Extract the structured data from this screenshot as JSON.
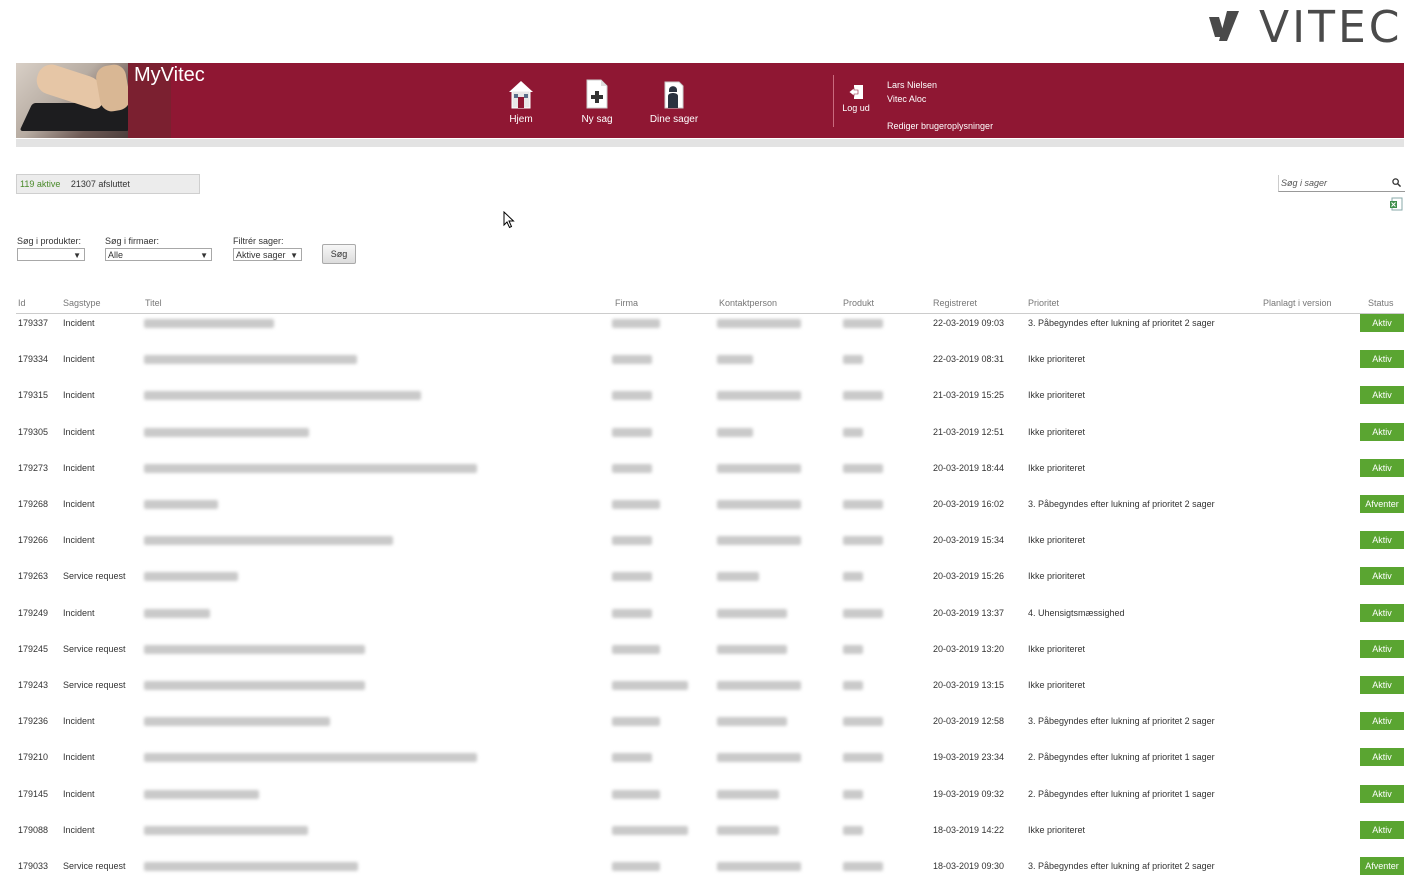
{
  "brand": {
    "logo_text": "VITEC",
    "logo_color": "#4a4a4a",
    "icon": "vitec-logo-icon"
  },
  "header": {
    "app_title": "MyVitec",
    "bg_color": "#8f1733",
    "nav": [
      {
        "label": "Hjem",
        "icon": "home-icon"
      },
      {
        "label": "Ny sag",
        "icon": "new-case-icon"
      },
      {
        "label": "Dine sager",
        "icon": "my-cases-icon"
      }
    ],
    "logout_label": "Log ud",
    "user_name": "Lars Nielsen",
    "company": "Vitec Aloc",
    "edit_user_label": "Rediger brugeroplysninger"
  },
  "counts": {
    "active": "119 aktive",
    "closed": "21307 afsluttet"
  },
  "search": {
    "placeholder": "Søg i sager"
  },
  "filters": {
    "products_label": "Søg i produkter:",
    "products_value": "",
    "firms_label": "Søg i firmaer:",
    "firms_value": "Alle",
    "cases_label": "Filtrér sager:",
    "cases_value": "Aktive sager",
    "search_button": "Søg"
  },
  "table": {
    "columns": [
      "Id",
      "Sagstype",
      "Titel",
      "Firma",
      "Kontaktperson",
      "Produkt",
      "Registreret",
      "Prioritet",
      "Planlagt i version",
      "Status"
    ],
    "rows": [
      {
        "id": "179337",
        "type": "Incident",
        "registered": "22-03-2019 09:03",
        "priority": "3. Påbegyndes efter lukning af prioritet 2 sager",
        "status": "Aktiv"
      },
      {
        "id": "179334",
        "type": "Incident",
        "registered": "22-03-2019 08:31",
        "priority": "Ikke prioriteret",
        "status": "Aktiv"
      },
      {
        "id": "179315",
        "type": "Incident",
        "registered": "21-03-2019 15:25",
        "priority": "Ikke prioriteret",
        "status": "Aktiv"
      },
      {
        "id": "179305",
        "type": "Incident",
        "registered": "21-03-2019 12:51",
        "priority": "Ikke prioriteret",
        "status": "Aktiv"
      },
      {
        "id": "179273",
        "type": "Incident",
        "registered": "20-03-2019 18:44",
        "priority": "Ikke prioriteret",
        "status": "Aktiv"
      },
      {
        "id": "179268",
        "type": "Incident",
        "registered": "20-03-2019 16:02",
        "priority": "3. Påbegyndes efter lukning af prioritet 2 sager",
        "status": "Afventer"
      },
      {
        "id": "179266",
        "type": "Incident",
        "registered": "20-03-2019 15:34",
        "priority": "Ikke prioriteret",
        "status": "Aktiv"
      },
      {
        "id": "179263",
        "type": "Service request",
        "registered": "20-03-2019 15:26",
        "priority": "Ikke prioriteret",
        "status": "Aktiv"
      },
      {
        "id": "179249",
        "type": "Incident",
        "registered": "20-03-2019 13:37",
        "priority": "4. Uhensigtsmæssighed",
        "status": "Aktiv"
      },
      {
        "id": "179245",
        "type": "Service request",
        "registered": "20-03-2019 13:20",
        "priority": "Ikke prioriteret",
        "status": "Aktiv"
      },
      {
        "id": "179243",
        "type": "Service request",
        "registered": "20-03-2019 13:15",
        "priority": "Ikke prioriteret",
        "status": "Aktiv"
      },
      {
        "id": "179236",
        "type": "Incident",
        "registered": "20-03-2019 12:58",
        "priority": "3. Påbegyndes efter lukning af prioritet 2 sager",
        "status": "Aktiv"
      },
      {
        "id": "179210",
        "type": "Incident",
        "registered": "19-03-2019 23:34",
        "priority": "2. Påbegyndes efter lukning af prioritet 1 sager",
        "status": "Aktiv"
      },
      {
        "id": "179145",
        "type": "Incident",
        "registered": "19-03-2019 09:32",
        "priority": "2. Påbegyndes efter lukning af prioritet 1 sager",
        "status": "Aktiv"
      },
      {
        "id": "179088",
        "type": "Incident",
        "registered": "18-03-2019 14:22",
        "priority": "Ikke prioriteret",
        "status": "Aktiv"
      },
      {
        "id": "179033",
        "type": "Service request",
        "registered": "18-03-2019 09:30",
        "priority": "3. Påbegyndes efter lukning af prioritet 2 sager",
        "status": "Afventer"
      }
    ]
  },
  "colors": {
    "status_active": "#5aa531",
    "accent": "#8f1733"
  }
}
